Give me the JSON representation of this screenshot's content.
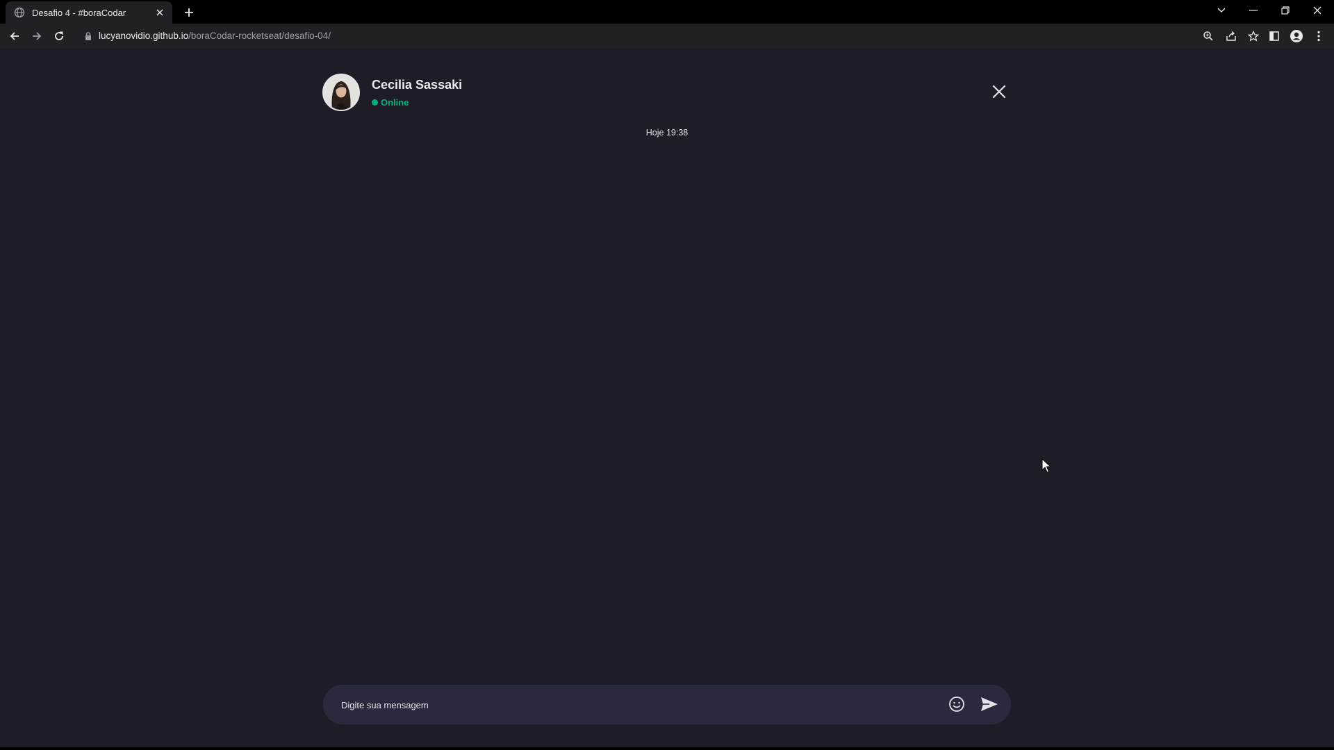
{
  "browser": {
    "tab_title": "Desafio 4 - #boraCodar",
    "url_host": "lucyanovidio.github.io",
    "url_path": "/boraCodar-rocketseat/desafio-04/"
  },
  "chat": {
    "contact_name": "Cecilia Sassaki",
    "status": "Online",
    "status_color": "#00b37e",
    "timestamp": "Hoje 19:38",
    "input_placeholder": "Digite sua mensagem"
  },
  "colors": {
    "background": "#1e1d27",
    "composer": "#2a2a3e",
    "text": "#e1e1e6"
  },
  "icons": [
    "globe-icon",
    "close-tab-icon",
    "plus-icon",
    "back-icon",
    "forward-icon",
    "reload-icon",
    "lock-icon",
    "zoom-icon",
    "share-icon",
    "star-icon",
    "sidepanel-icon",
    "profile-icon",
    "menu-icon",
    "close-icon",
    "emoji-icon",
    "send-icon"
  ]
}
